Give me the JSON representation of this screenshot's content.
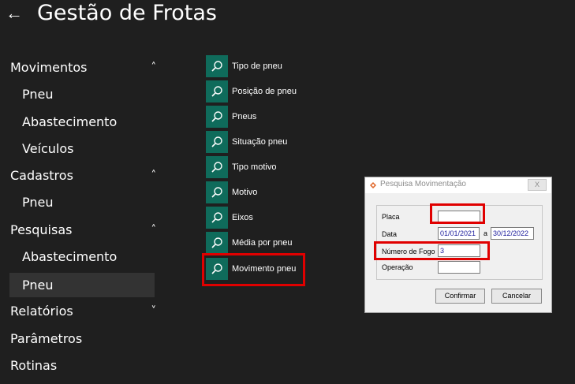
{
  "header": {
    "back_icon": "←",
    "title": "Gestão de Frotas"
  },
  "nav": {
    "sections": [
      {
        "label": "Movimentos",
        "chevron": "^",
        "items": [
          "Pneu",
          "Abastecimento",
          "Veículos"
        ]
      },
      {
        "label": "Cadastros",
        "chevron": "^",
        "items": [
          "Pneu"
        ]
      },
      {
        "label": "Pesquisas",
        "chevron": "^",
        "items": [
          "Abastecimento",
          "Pneu"
        ],
        "selected": "Pneu"
      },
      {
        "label": "Relatórios",
        "chevron": "v",
        "items": []
      },
      {
        "label": "Parâmetros",
        "items": []
      },
      {
        "label": "Rotinas",
        "items": []
      }
    ]
  },
  "menu": {
    "icon": "search-icon",
    "items": [
      "Tipo de pneu",
      "Posição de pneu",
      "Pneus",
      "Situação pneu",
      "Tipo motivo",
      "Motivo",
      "Eixos",
      "Média por pneu",
      "Movimento pneu"
    ],
    "highlighted": "Movimento pneu"
  },
  "dialog": {
    "title": "Pesquisa Movimentação",
    "close": "X",
    "labels": {
      "placa": "Placa",
      "data": "Data",
      "numero_fogo": "Número de Fogo",
      "operacao": "Operação",
      "a": "a"
    },
    "values": {
      "placa": "",
      "data_inicio": "01/01/2021",
      "data_fim": "30/12/2022",
      "numero_fogo": "3",
      "operacao": ""
    },
    "buttons": {
      "confirmar": "Confirmar",
      "cancelar": "Cancelar"
    }
  },
  "colors": {
    "background": "#1f1f1f",
    "icon_tile": "#0f6b5b",
    "highlight": "#e00000",
    "selected_item": "#333333"
  }
}
